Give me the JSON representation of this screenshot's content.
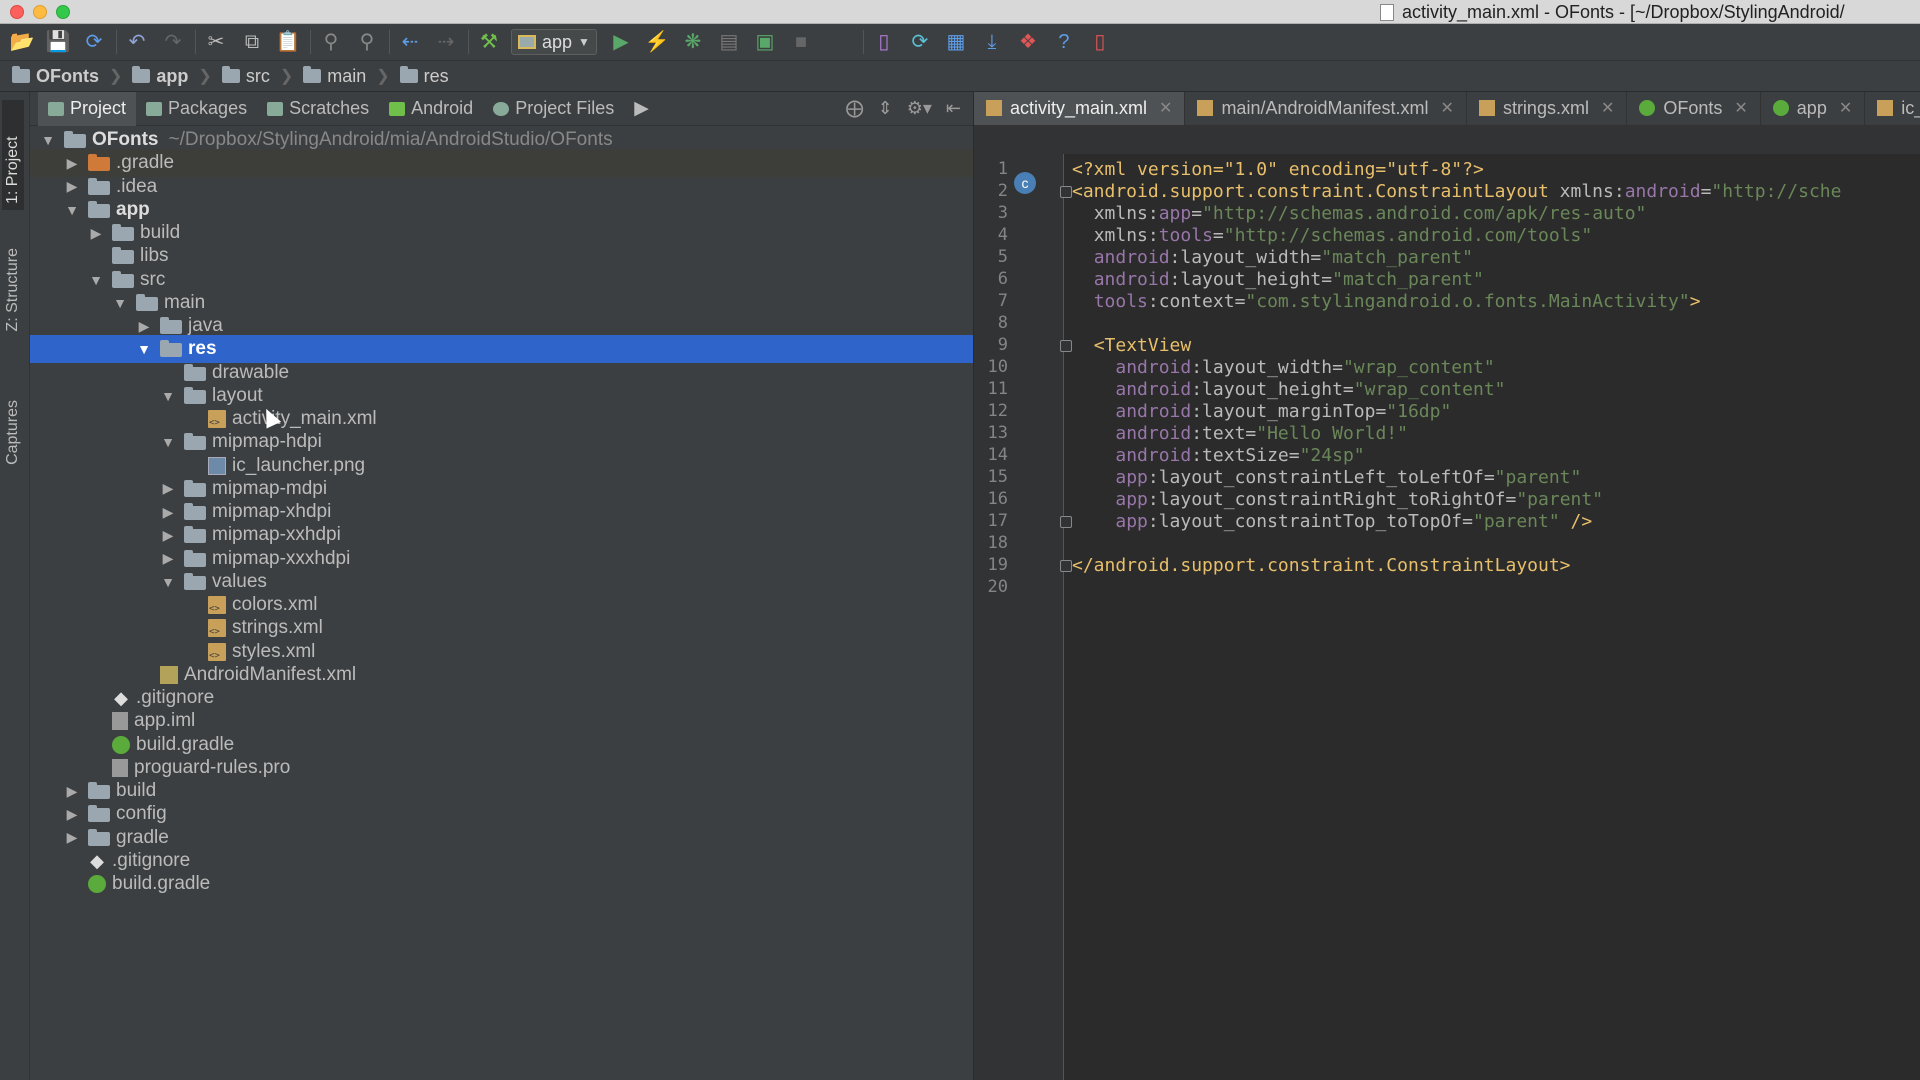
{
  "window": {
    "title": "activity_main.xml - OFonts - [~/Dropbox/StylingAndroid/"
  },
  "toolbar": {
    "run_config": "app"
  },
  "breadcrumb": [
    "OFonts",
    "app",
    "src",
    "main",
    "res"
  ],
  "left_stripe": {
    "project": "1: Project",
    "structure": "Z: Structure",
    "captures": "Captures"
  },
  "project_panel": {
    "tabs": [
      "Project",
      "Packages",
      "Scratches",
      "Android",
      "Project Files"
    ],
    "tree": [
      {
        "name": "OFonts",
        "path": "~/Dropbox/StylingAndroid/mia/AndroidStudio/OFonts",
        "depth": 0,
        "arrow": "down",
        "icon": "module-folder-icon",
        "bold": true
      },
      {
        "name": ".gradle",
        "depth": 1,
        "arrow": "right",
        "icon": "excluded-folder-icon",
        "highlight": true
      },
      {
        "name": ".idea",
        "depth": 1,
        "arrow": "right",
        "icon": "folder-icon"
      },
      {
        "name": "app",
        "depth": 1,
        "arrow": "down",
        "icon": "module-folder-icon",
        "bold": true
      },
      {
        "name": "build",
        "depth": 2,
        "arrow": "right",
        "icon": "folder-icon"
      },
      {
        "name": "libs",
        "depth": 2,
        "arrow": "none",
        "icon": "folder-icon"
      },
      {
        "name": "src",
        "depth": 2,
        "arrow": "down",
        "icon": "folder-icon"
      },
      {
        "name": "main",
        "depth": 3,
        "arrow": "down",
        "icon": "folder-icon"
      },
      {
        "name": "java",
        "depth": 4,
        "arrow": "right",
        "icon": "source-folder-icon"
      },
      {
        "name": "res",
        "depth": 4,
        "arrow": "down",
        "icon": "resource-folder-icon",
        "selected": true
      },
      {
        "name": "drawable",
        "depth": 5,
        "arrow": "none",
        "icon": "folder-icon"
      },
      {
        "name": "layout",
        "depth": 5,
        "arrow": "down",
        "icon": "folder-icon"
      },
      {
        "name": "activity_main.xml",
        "depth": 6,
        "arrow": "none",
        "icon": "xml-file-icon"
      },
      {
        "name": "mipmap-hdpi",
        "depth": 5,
        "arrow": "down",
        "icon": "folder-icon"
      },
      {
        "name": "ic_launcher.png",
        "depth": 6,
        "arrow": "none",
        "icon": "image-file-icon"
      },
      {
        "name": "mipmap-mdpi",
        "depth": 5,
        "arrow": "right",
        "icon": "folder-icon"
      },
      {
        "name": "mipmap-xhdpi",
        "depth": 5,
        "arrow": "right",
        "icon": "folder-icon"
      },
      {
        "name": "mipmap-xxhdpi",
        "depth": 5,
        "arrow": "right",
        "icon": "folder-icon"
      },
      {
        "name": "mipmap-xxxhdpi",
        "depth": 5,
        "arrow": "right",
        "icon": "folder-icon"
      },
      {
        "name": "values",
        "depth": 5,
        "arrow": "down",
        "icon": "folder-icon"
      },
      {
        "name": "colors.xml",
        "depth": 6,
        "arrow": "none",
        "icon": "xml-file-icon"
      },
      {
        "name": "strings.xml",
        "depth": 6,
        "arrow": "none",
        "icon": "xml-file-icon"
      },
      {
        "name": "styles.xml",
        "depth": 6,
        "arrow": "none",
        "icon": "xml-file-icon"
      },
      {
        "name": "AndroidManifest.xml",
        "depth": 4,
        "arrow": "none",
        "icon": "manifest-file-icon"
      },
      {
        "name": ".gitignore",
        "depth": 2,
        "arrow": "none",
        "icon": "git-file-icon"
      },
      {
        "name": "app.iml",
        "depth": 2,
        "arrow": "none",
        "icon": "iml-file-icon"
      },
      {
        "name": "build.gradle",
        "depth": 2,
        "arrow": "none",
        "icon": "gradle-file-icon"
      },
      {
        "name": "proguard-rules.pro",
        "depth": 2,
        "arrow": "none",
        "icon": "text-file-icon"
      },
      {
        "name": "build",
        "depth": 1,
        "arrow": "right",
        "icon": "folder-icon"
      },
      {
        "name": "config",
        "depth": 1,
        "arrow": "right",
        "icon": "folder-icon"
      },
      {
        "name": "gradle",
        "depth": 1,
        "arrow": "right",
        "icon": "folder-icon"
      },
      {
        "name": ".gitignore",
        "depth": 1,
        "arrow": "none",
        "icon": "git-file-icon"
      },
      {
        "name": "build.gradle",
        "depth": 1,
        "arrow": "none",
        "icon": "gradle-file-icon"
      }
    ]
  },
  "editor": {
    "tabs": [
      {
        "label": "activity_main.xml",
        "active": true,
        "icon": "xml-file-icon"
      },
      {
        "label": "main/AndroidManifest.xml",
        "active": false,
        "icon": "xml-file-icon"
      },
      {
        "label": "strings.xml",
        "active": false,
        "icon": "xml-file-icon"
      },
      {
        "label": "OFonts",
        "active": false,
        "icon": "gradle-file-icon"
      },
      {
        "label": "app",
        "active": false,
        "icon": "gradle-file-icon"
      },
      {
        "label": "ic_",
        "active": false,
        "icon": "xml-file-icon"
      }
    ],
    "lines": [
      [
        [
          "decl",
          "<?xml version=\"1.0\" encoding=\"utf-8\"?>"
        ]
      ],
      [
        [
          "tag",
          "<android.support.constraint.ConstraintLayout "
        ],
        [
          "attr",
          "xmlns:"
        ],
        [
          "ns",
          "android"
        ],
        [
          "attr",
          "="
        ],
        [
          "val",
          "\"http://sche"
        ]
      ],
      [
        [
          "plain",
          "  "
        ],
        [
          "attr",
          "xmlns:"
        ],
        [
          "ns",
          "app"
        ],
        [
          "attr",
          "="
        ],
        [
          "val",
          "\"http://schemas.android.com/apk/res-auto\""
        ]
      ],
      [
        [
          "plain",
          "  "
        ],
        [
          "attr",
          "xmlns:"
        ],
        [
          "ns",
          "tools"
        ],
        [
          "attr",
          "="
        ],
        [
          "val",
          "\"http://schemas.android.com/tools\""
        ]
      ],
      [
        [
          "plain",
          "  "
        ],
        [
          "ns",
          "android"
        ],
        [
          "attr",
          ":layout_width="
        ],
        [
          "val",
          "\"match_parent\""
        ]
      ],
      [
        [
          "plain",
          "  "
        ],
        [
          "ns",
          "android"
        ],
        [
          "attr",
          ":layout_height="
        ],
        [
          "val",
          "\"match_parent\""
        ]
      ],
      [
        [
          "plain",
          "  "
        ],
        [
          "ns",
          "tools"
        ],
        [
          "attr",
          ":context="
        ],
        [
          "val",
          "\"com.stylingandroid.o.fonts.MainActivity\""
        ],
        [
          "tag",
          ">"
        ]
      ],
      [],
      [
        [
          "plain",
          "  "
        ],
        [
          "tag",
          "<TextView"
        ]
      ],
      [
        [
          "plain",
          "    "
        ],
        [
          "ns",
          "android"
        ],
        [
          "attr",
          ":layout_width="
        ],
        [
          "val",
          "\"wrap_content\""
        ]
      ],
      [
        [
          "plain",
          "    "
        ],
        [
          "ns",
          "android"
        ],
        [
          "attr",
          ":layout_height="
        ],
        [
          "val",
          "\"wrap_content\""
        ]
      ],
      [
        [
          "plain",
          "    "
        ],
        [
          "ns",
          "android"
        ],
        [
          "attr",
          ":layout_marginTop="
        ],
        [
          "val",
          "\"16dp\""
        ]
      ],
      [
        [
          "plain",
          "    "
        ],
        [
          "ns",
          "android"
        ],
        [
          "attr",
          ":text="
        ],
        [
          "val",
          "\"Hello World!\""
        ]
      ],
      [
        [
          "plain",
          "    "
        ],
        [
          "ns",
          "android"
        ],
        [
          "attr",
          ":textSize="
        ],
        [
          "val",
          "\"24sp\""
        ]
      ],
      [
        [
          "plain",
          "    "
        ],
        [
          "ns",
          "app"
        ],
        [
          "attr",
          ":layout_constraintLeft_toLeftOf="
        ],
        [
          "val",
          "\"parent\""
        ]
      ],
      [
        [
          "plain",
          "    "
        ],
        [
          "ns",
          "app"
        ],
        [
          "attr",
          ":layout_constraintRight_toRightOf="
        ],
        [
          "val",
          "\"parent\""
        ]
      ],
      [
        [
          "plain",
          "    "
        ],
        [
          "ns",
          "app"
        ],
        [
          "attr",
          ":layout_constraintTop_toTopOf="
        ],
        [
          "val",
          "\"parent\""
        ],
        [
          "tag",
          " />"
        ]
      ],
      [],
      [
        [
          "tag",
          "</android.support.constraint.ConstraintLayout>"
        ]
      ],
      []
    ],
    "line_numbers": [
      "1",
      "2",
      "3",
      "4",
      "5",
      "6",
      "7",
      "8",
      "9",
      "10",
      "11",
      "12",
      "13",
      "14",
      "15",
      "16",
      "17",
      "18",
      "19",
      "20"
    ]
  }
}
